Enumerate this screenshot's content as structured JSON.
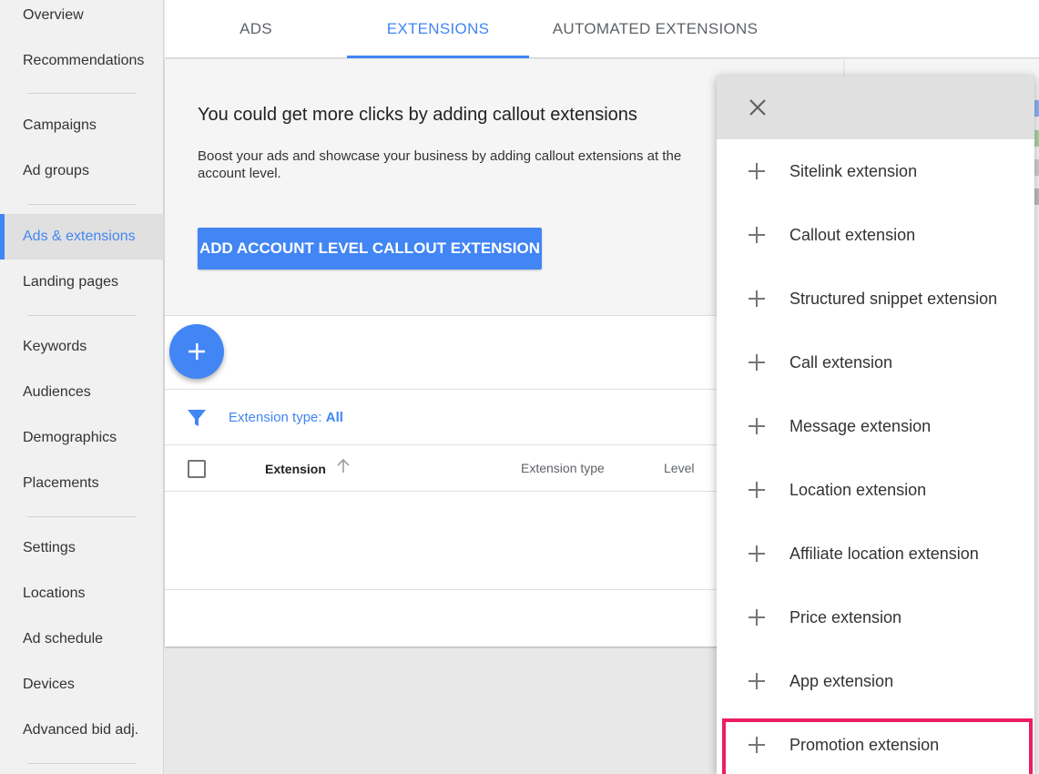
{
  "sidebar": {
    "items": [
      {
        "label": "Overview"
      },
      {
        "label": "Recommendations"
      },
      {
        "label": "Campaigns"
      },
      {
        "label": "Ad groups"
      },
      {
        "label": "Ads & extensions"
      },
      {
        "label": "Landing pages"
      },
      {
        "label": "Keywords"
      },
      {
        "label": "Audiences"
      },
      {
        "label": "Demographics"
      },
      {
        "label": "Placements"
      },
      {
        "label": "Settings"
      },
      {
        "label": "Locations"
      },
      {
        "label": "Ad schedule"
      },
      {
        "label": "Devices"
      },
      {
        "label": "Advanced bid adj."
      }
    ],
    "active_item": "Ads & extensions"
  },
  "tabs": [
    {
      "label": "ADS"
    },
    {
      "label": "EXTENSIONS"
    },
    {
      "label": "AUTOMATED EXTENSIONS"
    }
  ],
  "active_tab": "EXTENSIONS",
  "promo": {
    "title": "You could get more clicks by adding callout extensions",
    "description": "Boost your ads and showcase your business by adding callout extensions at the account level.",
    "button_label": "ADD ACCOUNT LEVEL CALLOUT EXTENSION"
  },
  "filter": {
    "label": "Extension type:",
    "value": "All"
  },
  "table": {
    "columns": [
      "Extension",
      "Extension type",
      "Level"
    ]
  },
  "menu": {
    "items": [
      {
        "label": "Sitelink extension"
      },
      {
        "label": "Callout extension"
      },
      {
        "label": "Structured snippet extension"
      },
      {
        "label": "Call extension"
      },
      {
        "label": "Message extension"
      },
      {
        "label": "Location extension"
      },
      {
        "label": "Affiliate location extension"
      },
      {
        "label": "Price extension"
      },
      {
        "label": "App extension"
      },
      {
        "label": "Promotion extension"
      }
    ],
    "highlighted_item": "Promotion extension"
  },
  "colors": {
    "accent": "#4285f4",
    "highlight": "#ea1e63"
  }
}
